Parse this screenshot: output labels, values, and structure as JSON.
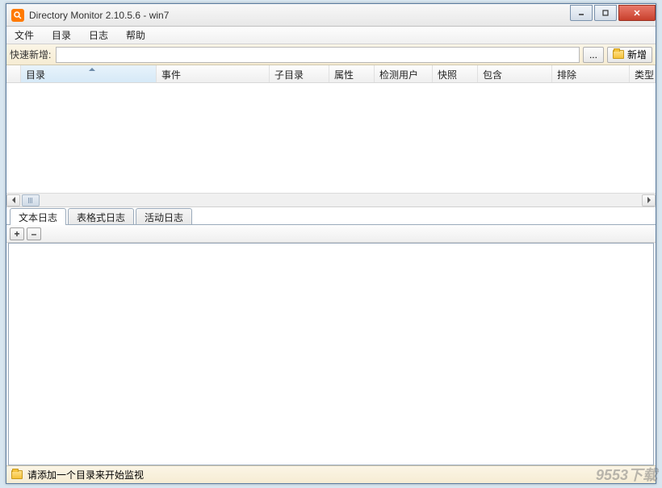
{
  "window": {
    "title": "Directory Monitor 2.10.5.6 - win7"
  },
  "menubar": {
    "file": "文件",
    "directory": "目录",
    "log": "日志",
    "help": "帮助"
  },
  "quickadd": {
    "label": "快速新增:",
    "value": "",
    "browse_label": "...",
    "add_label": "新增"
  },
  "table": {
    "columns": {
      "directory": "目录",
      "event": "事件",
      "subdir": "子目录",
      "attribute": "属性",
      "detect_user": "检测用户",
      "snapshot": "快照",
      "include": "包含",
      "exclude": "排除",
      "type": "类型"
    }
  },
  "tabs": {
    "text_log": "文本日志",
    "table_log": "表格式日志",
    "activity_log": "活动日志"
  },
  "log_toolbar": {
    "expand": "+",
    "collapse": "–"
  },
  "statusbar": {
    "message": "请添加一个目录来开始监视"
  },
  "watermark": "9553下载"
}
